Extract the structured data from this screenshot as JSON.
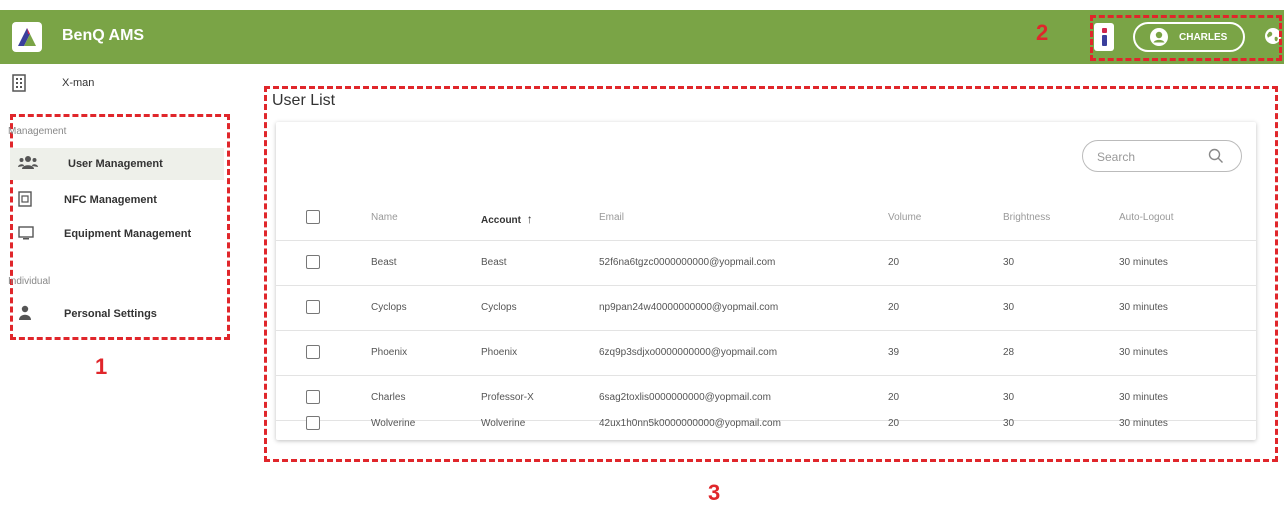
{
  "header": {
    "app_title": "BenQ AMS",
    "user_name": "CHARLES",
    "brand_color": "#7aa446",
    "icons": [
      "benq-logo-icon",
      "info-icon",
      "account-circle-icon",
      "globe-icon"
    ]
  },
  "sidebar": {
    "org_name": "X-man",
    "management_label": "Management",
    "individual_label": "Individual",
    "items": [
      {
        "label": "User Management",
        "icon": "users-icon",
        "active": true
      },
      {
        "label": "NFC Management",
        "icon": "nfc-card-icon",
        "active": false
      },
      {
        "label": "Equipment Management",
        "icon": "monitor-icon",
        "active": false
      },
      {
        "label": "Personal Settings",
        "icon": "person-icon",
        "active": false
      }
    ]
  },
  "main": {
    "title": "User List",
    "search_placeholder": "Search",
    "columns": [
      "Name",
      "Account",
      "Email",
      "Volume",
      "Brightness",
      "Auto-Logout"
    ],
    "sort_column": "Account",
    "sort_indicator": "↑",
    "rows": [
      {
        "name": "Beast",
        "account": "Beast",
        "email": "52f6na6tgzc0000000000@yopmail.com",
        "volume": "20",
        "brightness": "30",
        "auto_logout": "30 minutes"
      },
      {
        "name": "Cyclops",
        "account": "Cyclops",
        "email": "np9pan24w40000000000@yopmail.com",
        "volume": "20",
        "brightness": "30",
        "auto_logout": "30 minutes"
      },
      {
        "name": "Phoenix",
        "account": "Phoenix",
        "email": "6zq9p3sdjxo0000000000@yopmail.com",
        "volume": "39",
        "brightness": "28",
        "auto_logout": "30 minutes"
      },
      {
        "name": "Charles",
        "account": "Professor-X",
        "email": "6sag2toxlis0000000000@yopmail.com",
        "volume": "20",
        "brightness": "30",
        "auto_logout": "30 minutes"
      },
      {
        "name": "Wolverine",
        "account": "Wolverine",
        "email": "42ux1h0nn5k0000000000@yopmail.com",
        "volume": "20",
        "brightness": "30",
        "auto_logout": "30 minutes"
      }
    ]
  },
  "annotations": {
    "label_1": "1",
    "label_2": "2",
    "label_3": "3",
    "color": "#e0262b"
  }
}
